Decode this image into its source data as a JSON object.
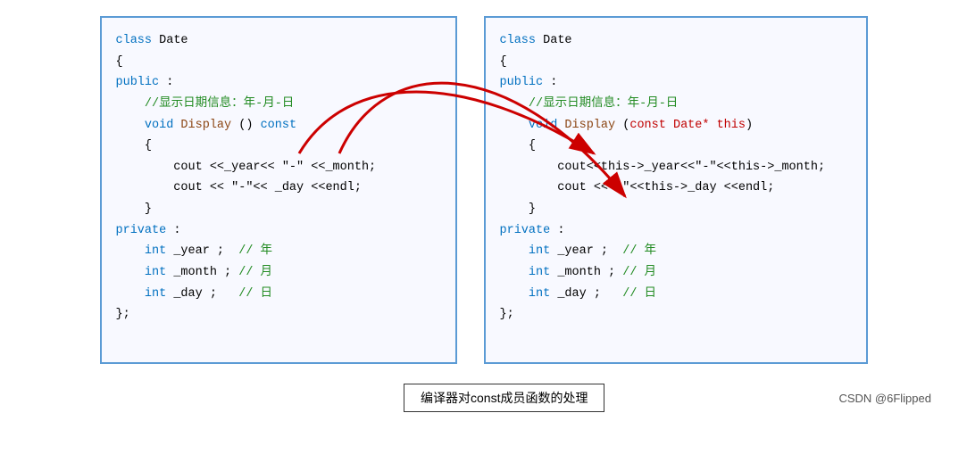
{
  "left_box": {
    "lines": [
      {
        "id": "l1",
        "text": "class Date"
      },
      {
        "id": "l2",
        "text": "{"
      },
      {
        "id": "l3",
        "text": "public :"
      },
      {
        "id": "l4",
        "text": "    //显示日期信息：年-月-日",
        "type": "comment"
      },
      {
        "id": "l5",
        "text": "    void Display () const",
        "type": "mixed"
      },
      {
        "id": "l6",
        "text": "    {"
      },
      {
        "id": "l7",
        "text": "        cout <<_year<< \"-\" <<_month;"
      },
      {
        "id": "l8",
        "text": "        cout << \"-\"<< _day <<endl;"
      },
      {
        "id": "l9",
        "text": "    }"
      },
      {
        "id": "l10",
        "text": "private :"
      },
      {
        "id": "l11",
        "text": "    int _year ;  // 年",
        "type": "int_comment"
      },
      {
        "id": "l12",
        "text": "    int _month ; // 月",
        "type": "int_comment"
      },
      {
        "id": "l13",
        "text": "    int _day ;   // 日",
        "type": "int_comment"
      },
      {
        "id": "l14",
        "text": "};"
      }
    ]
  },
  "right_box": {
    "lines": [
      {
        "id": "r1",
        "text": "class Date"
      },
      {
        "id": "r2",
        "text": "{"
      },
      {
        "id": "r3",
        "text": "public :"
      },
      {
        "id": "r4",
        "text": "    //显示日期信息：年-月-日",
        "type": "comment"
      },
      {
        "id": "r5a",
        "text": "    void Display (",
        "r5b": "const Date* this",
        "r5c": ")"
      },
      {
        "id": "r6",
        "text": "    {"
      },
      {
        "id": "r7",
        "text": "        cout<<this->_year<<\"-\"<<this->_month;"
      },
      {
        "id": "r8",
        "text": "        cout <<\"-\"<<this->_day <<endl;"
      },
      {
        "id": "r9",
        "text": "    }"
      },
      {
        "id": "r10",
        "text": "private :"
      },
      {
        "id": "r11",
        "text": "    int _year ;  // 年",
        "type": "int_comment"
      },
      {
        "id": "r12",
        "text": "    int _month ; // 月",
        "type": "int_comment"
      },
      {
        "id": "r13",
        "text": "    int _day ;   // 日",
        "type": "int_comment"
      },
      {
        "id": "r14",
        "text": "};"
      }
    ]
  },
  "caption": "编译器对const成员函数的处理",
  "branding": "CSDN @6Flipped"
}
